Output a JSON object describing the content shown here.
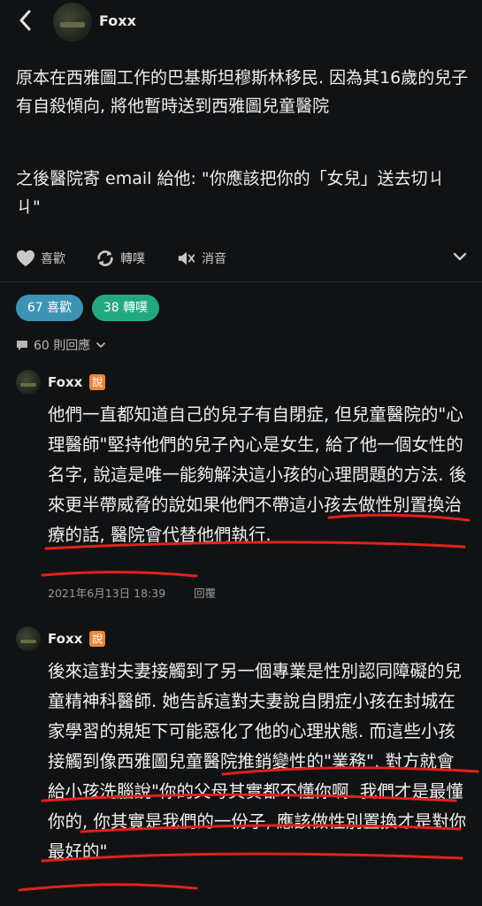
{
  "header": {
    "author": "Foxx"
  },
  "post": {
    "paragraph1": "原本在西雅圖工作的巴基斯坦穆斯林移民. 因為其16歲的兒子有自殺傾向, 將他暫時送到西雅圖兒童醫院",
    "paragraph2": "之後醫院寄 email 給他: \"你應該把你的「女兒」送去切ㄐㄐ\""
  },
  "actions": {
    "like": "喜歡",
    "share": "轉噗",
    "mute": "消音"
  },
  "stats": {
    "likes": "67 喜歡",
    "shares": "38 轉噗",
    "replies": "60 則回應"
  },
  "comments": [
    {
      "author": "Foxx",
      "badge": "說",
      "text": "他們一直都知道自己的兒子有自閉症, 但兒童醫院的\"心理醫師\"堅持他們的兒子內心是女生, 給了他一個女性的名字, 說這是唯一能夠解決這小孩的心理問題的方法. 後來更半帶威脅的說如果他們不帶這小孩去做性別置換治療的話, 醫院會代替他們執行.",
      "date": "2021年6月13日 18:39",
      "reply": "回覆"
    },
    {
      "author": "Foxx",
      "badge": "說",
      "text": "後來這對夫妻接觸到了另一個專業是性別認同障礙的兒童精神科醫師. 她告訴這對夫妻說自閉症小孩在封城在家學習的規矩下可能惡化了他的心理狀態. 而這些小孩接觸到像西雅圖兒童醫院推銷變性的\"業務\", 對方就會給小孩洗腦說\"你的父母其實都不懂你啊. 我們才是最懂你的, 你其實是我們的一份子, 應該做性別置換才是對你最好的\""
    }
  ],
  "colors": {
    "background": "#111214",
    "likes_pill": "#3d93b3",
    "shares_pill": "#23a982",
    "badge": "#e8873a",
    "underline": "#e0221b"
  }
}
